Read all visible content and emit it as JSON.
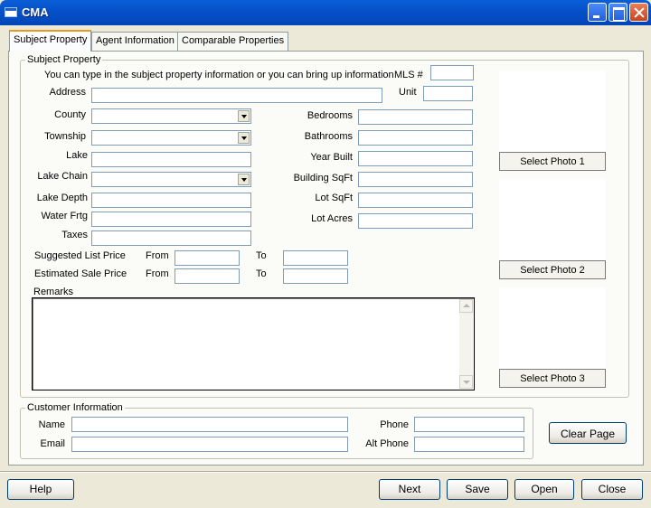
{
  "window": {
    "title": "CMA"
  },
  "tabs": [
    {
      "label": "Subject Property",
      "active": true
    },
    {
      "label": "Agent Information",
      "active": false
    },
    {
      "label": "Comparable Properties",
      "active": false
    }
  ],
  "subject_property": {
    "legend": "Subject Property",
    "instructions": "You can type in the subject property information or you can bring up information",
    "mls_label": "MLS #",
    "address_label": "Address",
    "unit_label": "Unit",
    "county_label": "County",
    "township_label": "Township",
    "lake_label": "Lake",
    "lake_chain_label": "Lake Chain",
    "lake_depth_label": "Lake Depth",
    "water_frtg_label": "Water Frtg",
    "taxes_label": "Taxes",
    "bedrooms_label": "Bedrooms",
    "bathrooms_label": "Bathrooms",
    "year_built_label": "Year Built",
    "building_sqft_label": "Building SqFt",
    "lot_sqft_label": "Lot SqFt",
    "lot_acres_label": "Lot Acres",
    "suggested_list_price_label": "Suggested List Price",
    "estimated_sale_price_label": "Estimated Sale Price",
    "from_label": "From",
    "to_label": "To",
    "remarks_label": "Remarks"
  },
  "photos": {
    "select_photo_1": "Select Photo 1",
    "select_photo_2": "Select Photo 2",
    "select_photo_3": "Select Photo 3"
  },
  "customer": {
    "legend": "Customer Information",
    "name_label": "Name",
    "email_label": "Email",
    "phone_label": "Phone",
    "alt_phone_label": "Alt Phone",
    "clear_page": "Clear Page"
  },
  "footer": {
    "help": "Help",
    "next": "Next",
    "save": "Save",
    "open": "Open",
    "close": "Close"
  },
  "colors": {
    "titlebar": "#0550c8",
    "window_bg": "#ece9d8",
    "panel_bg": "#fbfbf8",
    "active_tab_accent": "#e69a1e",
    "field_border": "#7f9db9"
  }
}
